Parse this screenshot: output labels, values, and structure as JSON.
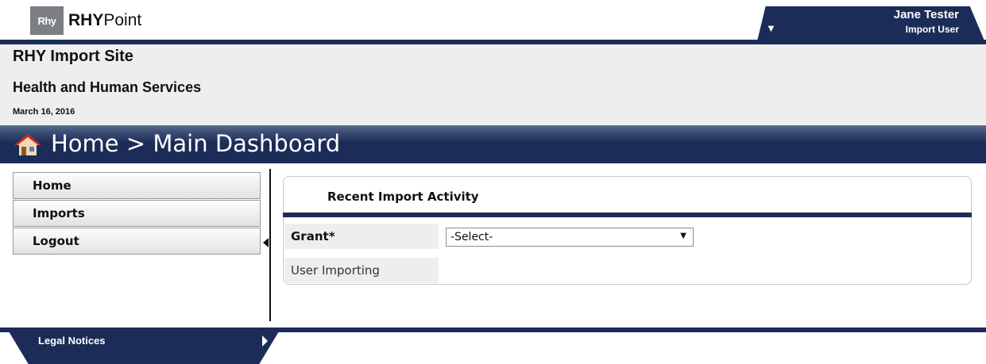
{
  "header": {
    "logo_badge": "Rhy",
    "logo_bold": "RHY",
    "logo_light": "Point",
    "user_name": "Jane Tester",
    "user_role": "Import User",
    "menu_caret_icon": "caret-down-icon"
  },
  "site": {
    "title": "RHY Import Site",
    "department": "Health and Human Services",
    "date": "March 16, 2016"
  },
  "breadcrumb": {
    "icon": "home-icon",
    "text": "Home > Main Dashboard"
  },
  "sidebar": {
    "items": [
      {
        "label": "Home"
      },
      {
        "label": "Imports"
      },
      {
        "label": "Logout"
      }
    ],
    "collapse_icon": "triangle-left-icon"
  },
  "panel": {
    "title": "Recent Import Activity",
    "grant_label": "Grant",
    "grant_required": "*",
    "grant_select_value": "-Select-",
    "user_importing_label": "User Importing"
  },
  "footer": {
    "legal_label": "Legal Notices",
    "legal_arrow_icon": "triangle-right-icon"
  },
  "colors": {
    "navy": "#1c2c58",
    "header_bg": "#eeeeee"
  }
}
